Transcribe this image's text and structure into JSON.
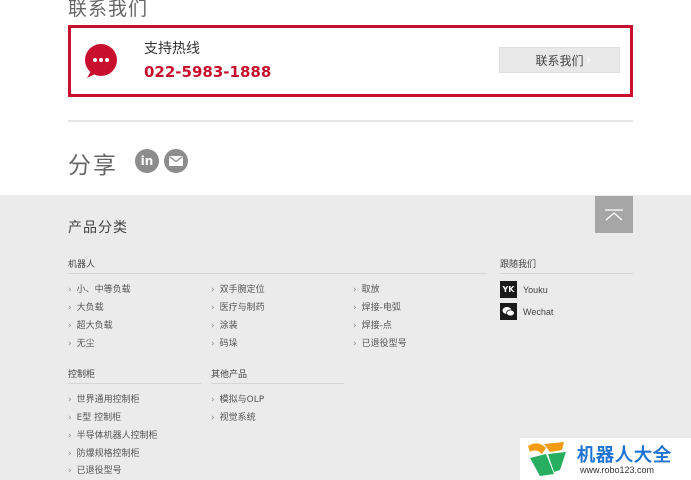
{
  "contact": {
    "section_title": "联系我们",
    "hotline_label": "支持热线",
    "hotline_phone": "022-5983-1888",
    "button_label": "联系我们",
    "chevron": "›"
  },
  "share": {
    "title": "分享",
    "icons": [
      "linkedin-icon",
      "mail-icon"
    ],
    "linkedin_glyph": "in"
  },
  "footer": {
    "category_title": "产品分类",
    "groups": {
      "robots": {
        "head": "机器人",
        "col1": [
          "小、中等负载",
          "大负载",
          "超大负载",
          "无尘"
        ],
        "col2": [
          "双手腕定位",
          "医疗与制药",
          "涂装",
          "码垛"
        ],
        "col3": [
          "取放",
          "焊接-电弧",
          "焊接-点",
          "已退役型号"
        ]
      },
      "controllers": {
        "head": "控制柜",
        "items": [
          "世界通用控制柜",
          "E型 控制柜",
          "半导体机器人控制柜",
          "防爆规格控制柜",
          "已退役型号"
        ]
      },
      "others": {
        "head": "其他产品",
        "items": [
          "模拟与OLP",
          "视觉系统"
        ]
      }
    },
    "follow": {
      "head": "跟随我们",
      "items": [
        {
          "icon_text": "YK",
          "label": "Youku"
        },
        {
          "icon_text": "WC",
          "label": "Wechat"
        }
      ]
    },
    "arrow_glyph": "›"
  },
  "watermark": {
    "title": "机器人大全",
    "url": "www.robo123.com"
  },
  "colors": {
    "accent_red": "#c8102e",
    "footer_bg": "#ebebeb",
    "watermark_blue": "#1d72d2"
  }
}
